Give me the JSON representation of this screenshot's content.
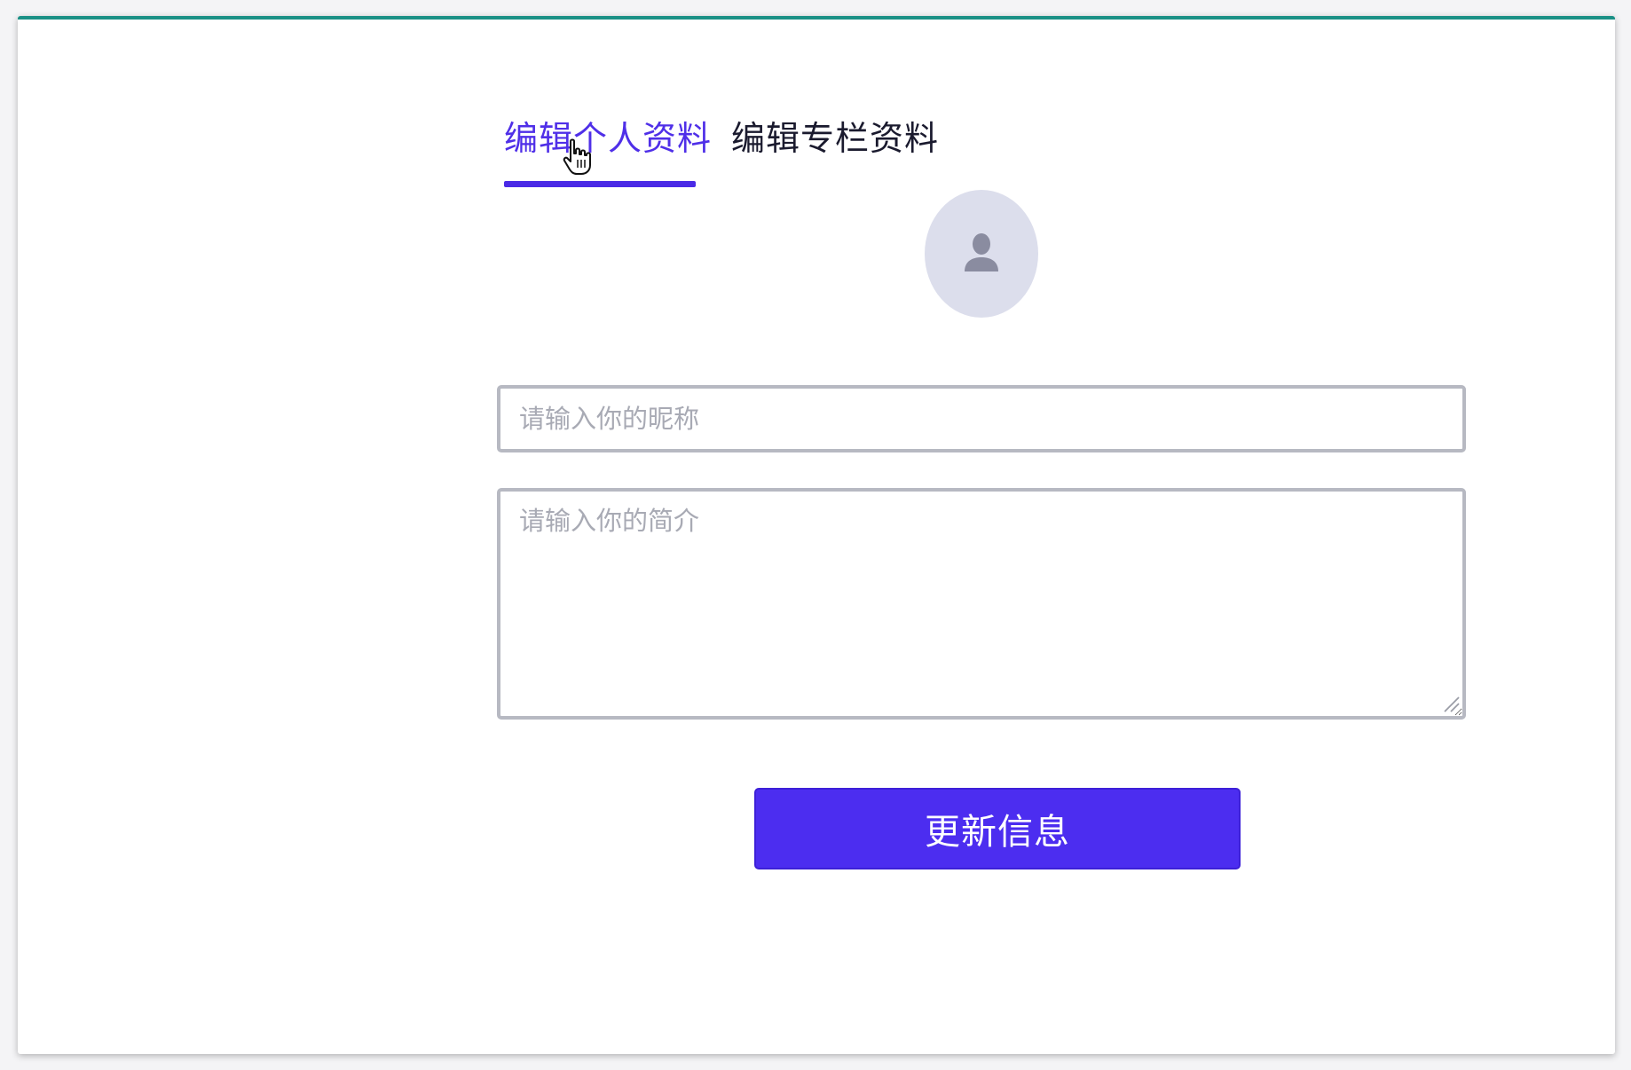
{
  "tabs": [
    {
      "label": "编辑个人资料",
      "active": true
    },
    {
      "label": "编辑专栏资料",
      "active": false
    }
  ],
  "avatar": {
    "icon": "user-silhouette-icon"
  },
  "form": {
    "nickname_placeholder": "请输入你的昵称",
    "nickname_value": "",
    "bio_placeholder": "请输入你的简介",
    "bio_value": ""
  },
  "submit_label": "更新信息",
  "colors": {
    "accent": "#4c2df0",
    "top_border": "#1a9086",
    "avatar_bg": "#dcdeec",
    "input_border": "#b7b9c2"
  }
}
